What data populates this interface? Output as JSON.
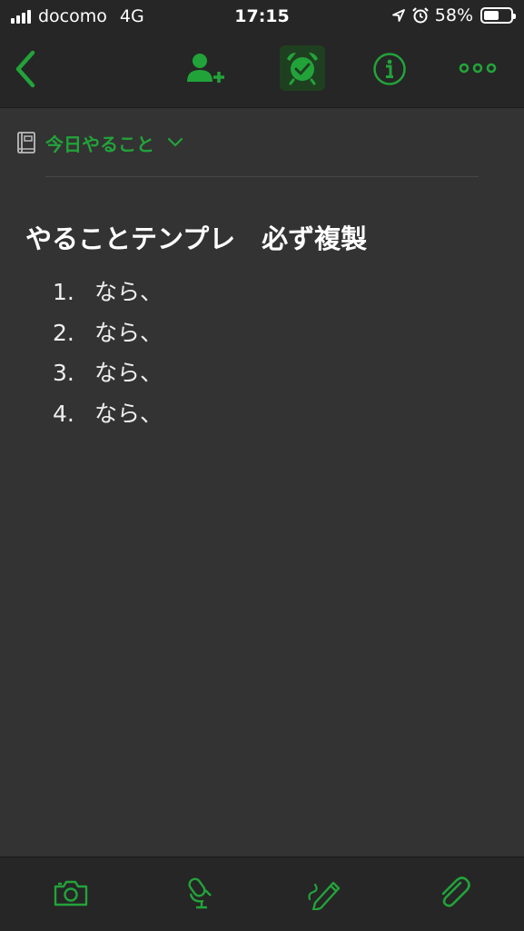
{
  "status_bar": {
    "carrier": "docomo",
    "network": "4G",
    "time": "17:15",
    "battery_percent": "58%",
    "battery_level": 0.58
  },
  "nav_bar": {
    "back_icon": "chevron-left-icon",
    "share_icon": "add-person-icon",
    "reminder_icon": "alarm-clock-check-icon",
    "info_icon": "info-circle-icon",
    "more_icon": "ellipsis-icon"
  },
  "notebook": {
    "icon": "notebook-icon",
    "name": "今日やること"
  },
  "note": {
    "title": "やることテンプレ　必ず複製",
    "items": [
      {
        "number": "1.",
        "text": "なら、"
      },
      {
        "number": "2.",
        "text": "なら、"
      },
      {
        "number": "3.",
        "text": "なら、"
      },
      {
        "number": "4.",
        "text": "なら、"
      }
    ]
  },
  "toolbar": {
    "camera_icon": "camera-icon",
    "audio_icon": "microphone-icon",
    "sketch_icon": "pen-icon",
    "attach_icon": "paperclip-icon"
  },
  "colors": {
    "accent": "#22a33a",
    "background": "#333333",
    "bar": "#262626"
  }
}
